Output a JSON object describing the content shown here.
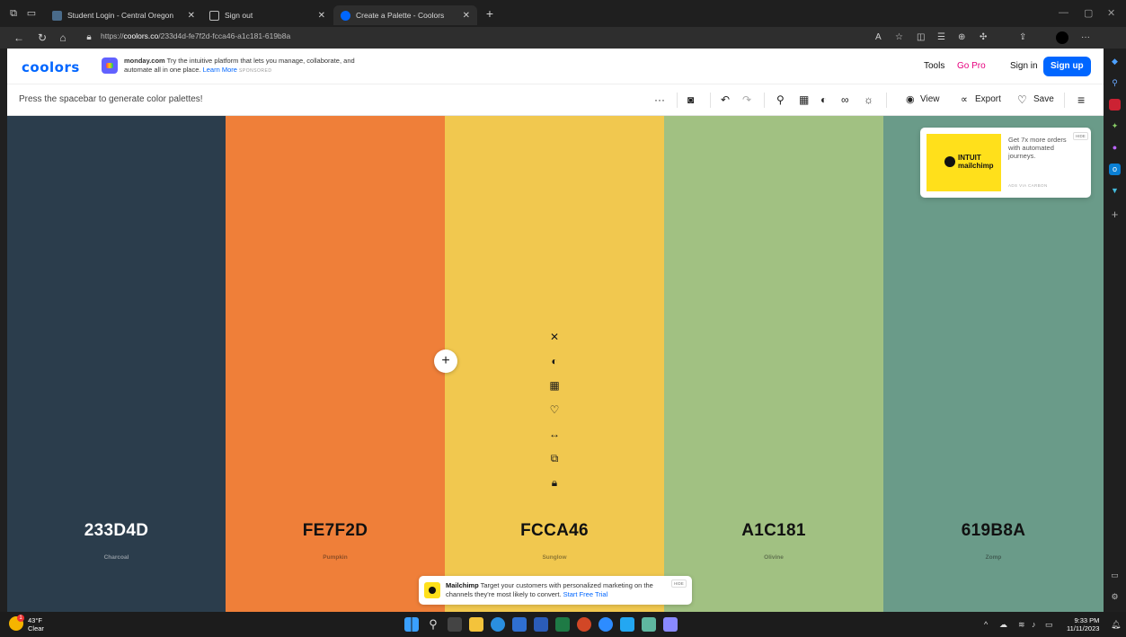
{
  "browser": {
    "tabs": [
      {
        "title": "Student Login - Central Oregon",
        "active": false
      },
      {
        "title": "Sign out",
        "active": false
      },
      {
        "title": "Create a Palette - Coolors",
        "active": true
      }
    ],
    "url_prefix": "https://",
    "url_domain": "coolors.co",
    "url_path": "/233d4d-fe7f2d-fcca46-a1c181-619b8a"
  },
  "header": {
    "logo": "coolors",
    "ad": {
      "brand": "monday.com",
      "text": "Try the intuitive platform that lets you manage, collaborate, and automate all in one place.",
      "learn_more": "Learn More",
      "sponsored": "SPONSORED"
    },
    "tools": "Tools",
    "go_pro": "Go Pro",
    "sign_in": "Sign in",
    "sign_up": "Sign up"
  },
  "toolbar": {
    "hint": "Press the spacebar to generate color palettes!",
    "view": "View",
    "export": "Export",
    "save": "Save"
  },
  "palette": [
    {
      "hex": "233D4D",
      "name": "Charcoal",
      "color": "#2b3d4c",
      "text_color": "#ffffff"
    },
    {
      "hex": "FE7F2D",
      "name": "Pumpkin",
      "color": "#ef7f39",
      "text_color": "#111111"
    },
    {
      "hex": "FCCA46",
      "name": "Sunglow",
      "color": "#f1c84f",
      "text_color": "#111111"
    },
    {
      "hex": "A1C181",
      "name": "Olivine",
      "color": "#a1c182",
      "text_color": "#111111"
    },
    {
      "hex": "619B8A",
      "name": "Zomp",
      "color": "#6a9b89",
      "text_color": "#111111"
    }
  ],
  "ad_card": {
    "brand_line1": "INTUIT",
    "brand_line2": "mailchimp",
    "copy": "Get 7x more orders with automated journeys.",
    "via": "ADS VIA CARBON",
    "hide": "HIDE"
  },
  "bottom_ad": {
    "brand": "Mailchimp",
    "text": "Target your customers with personalized marketing on the channels they're most likely to convert.",
    "cta": "Start Free Trial",
    "hide": "HIDE"
  },
  "taskbar": {
    "temp": "43°F",
    "condition": "Clear",
    "weather_badge": "1",
    "time": "9:33 PM",
    "date": "11/11/2023"
  }
}
